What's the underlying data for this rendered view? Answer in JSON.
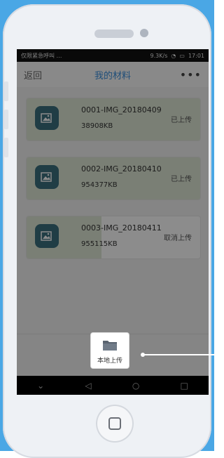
{
  "status_bar": {
    "carrier": "仅限紧急呼叫 …",
    "network_speed": "9.3K/s",
    "battery": "🔋",
    "time": "17:01"
  },
  "nav": {
    "back_label": "返回",
    "title": "我的材料",
    "more_label": "•••"
  },
  "files": [
    {
      "name": "0001-IMG_20180409",
      "size": "38908KB",
      "status": "已上传",
      "progress": 1.0
    },
    {
      "name": "0002-IMG_20180410",
      "size": "954377KB",
      "status": "已上传",
      "progress": 1.0
    },
    {
      "name": "0003-IMG_20180411",
      "size": "955115KB",
      "status": "取消上传",
      "progress": 0.43
    }
  ],
  "upload_button": {
    "label": "本地上传"
  },
  "android_nav": {
    "back": "◁",
    "home": "○",
    "recents": "□",
    "collapse": "⌄"
  },
  "colors": {
    "accent": "#3a8fdc",
    "background_blue": "#4aa7e5",
    "progress": "#dfe8d6",
    "thumb": "#3b6f7e"
  }
}
